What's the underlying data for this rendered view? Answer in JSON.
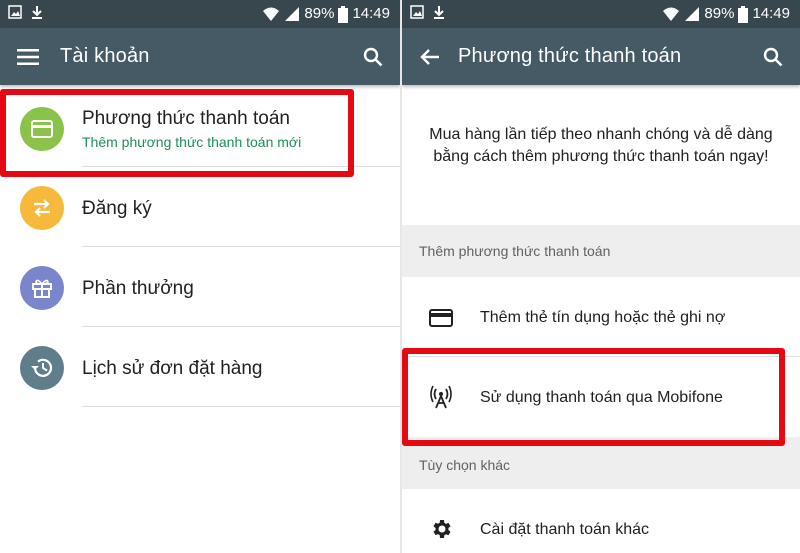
{
  "status_bar": {
    "battery": "89%",
    "time": "14:49"
  },
  "left_screen": {
    "title": "Tài khoản",
    "menu": [
      {
        "label": "Phương thức thanh toán",
        "sublabel": "Thêm phương thức thanh toán mới",
        "icon": "credit-card-icon",
        "color": "#8bc34a"
      },
      {
        "label": "Đăng ký",
        "icon": "swap-icon",
        "color": "#f6b93b"
      },
      {
        "label": "Phần thưởng",
        "icon": "gift-icon",
        "color": "#7986cb"
      },
      {
        "label": "Lịch sử đơn đặt hàng",
        "icon": "history-icon",
        "color": "#607d8b"
      }
    ]
  },
  "right_screen": {
    "title": "Phương thức thanh toán",
    "intro": "Mua hàng lần tiếp theo nhanh chóng và dễ dàng bằng cách thêm phương thức thanh toán ngay!",
    "section_add": "Thêm phương thức thanh toán",
    "options": [
      {
        "label": "Thêm thẻ tín dụng hoặc thẻ ghi nợ",
        "icon": "credit-card-icon"
      },
      {
        "label": "Sử dụng thanh toán qua Mobifone",
        "icon": "cell-tower-icon"
      }
    ],
    "section_other": "Tùy chọn khác",
    "other_options": [
      {
        "label": "Cài đặt thanh toán khác",
        "icon": "gear-icon"
      }
    ]
  },
  "colors": {
    "status_bar": "#38464e",
    "app_bar": "#455a64",
    "highlight": "#e50914",
    "accent_green": "#1e8e5a"
  }
}
